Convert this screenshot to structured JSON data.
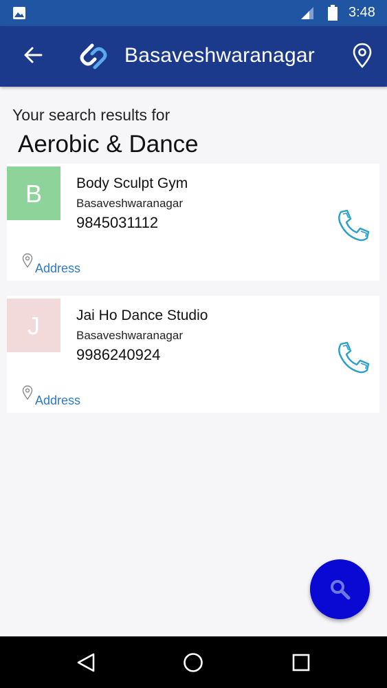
{
  "status_bar": {
    "time": "3:48"
  },
  "app_bar": {
    "title": "Basaveshwaranagar"
  },
  "search": {
    "caption": "Your search results for",
    "query": "Aerobic & Dance"
  },
  "results": [
    {
      "initial": "B",
      "avatar_color": "#8ed49a",
      "name": "Body Sculpt Gym",
      "area": "Basaveshwaranagar",
      "phone": "9845031112",
      "address_label": "Address"
    },
    {
      "initial": "J",
      "avatar_color": "#f2dada",
      "name": "Jai Ho Dance Studio",
      "area": "Basaveshwaranagar",
      "phone": "9986240924",
      "address_label": "Address"
    }
  ],
  "colors": {
    "status_bar": "#1f55a2",
    "app_bar": "#1b3a8c",
    "fab": "#0a09d4",
    "link": "#2d7ac0",
    "call_icon": "#2a9fc9"
  },
  "icons": [
    "image-icon",
    "signal-icon",
    "battery-icon",
    "back-arrow-icon",
    "app-logo-icon",
    "location-pin-icon",
    "phone-icon",
    "map-pin-icon",
    "search-icon",
    "nav-back-icon",
    "nav-home-icon",
    "nav-recent-icon"
  ]
}
